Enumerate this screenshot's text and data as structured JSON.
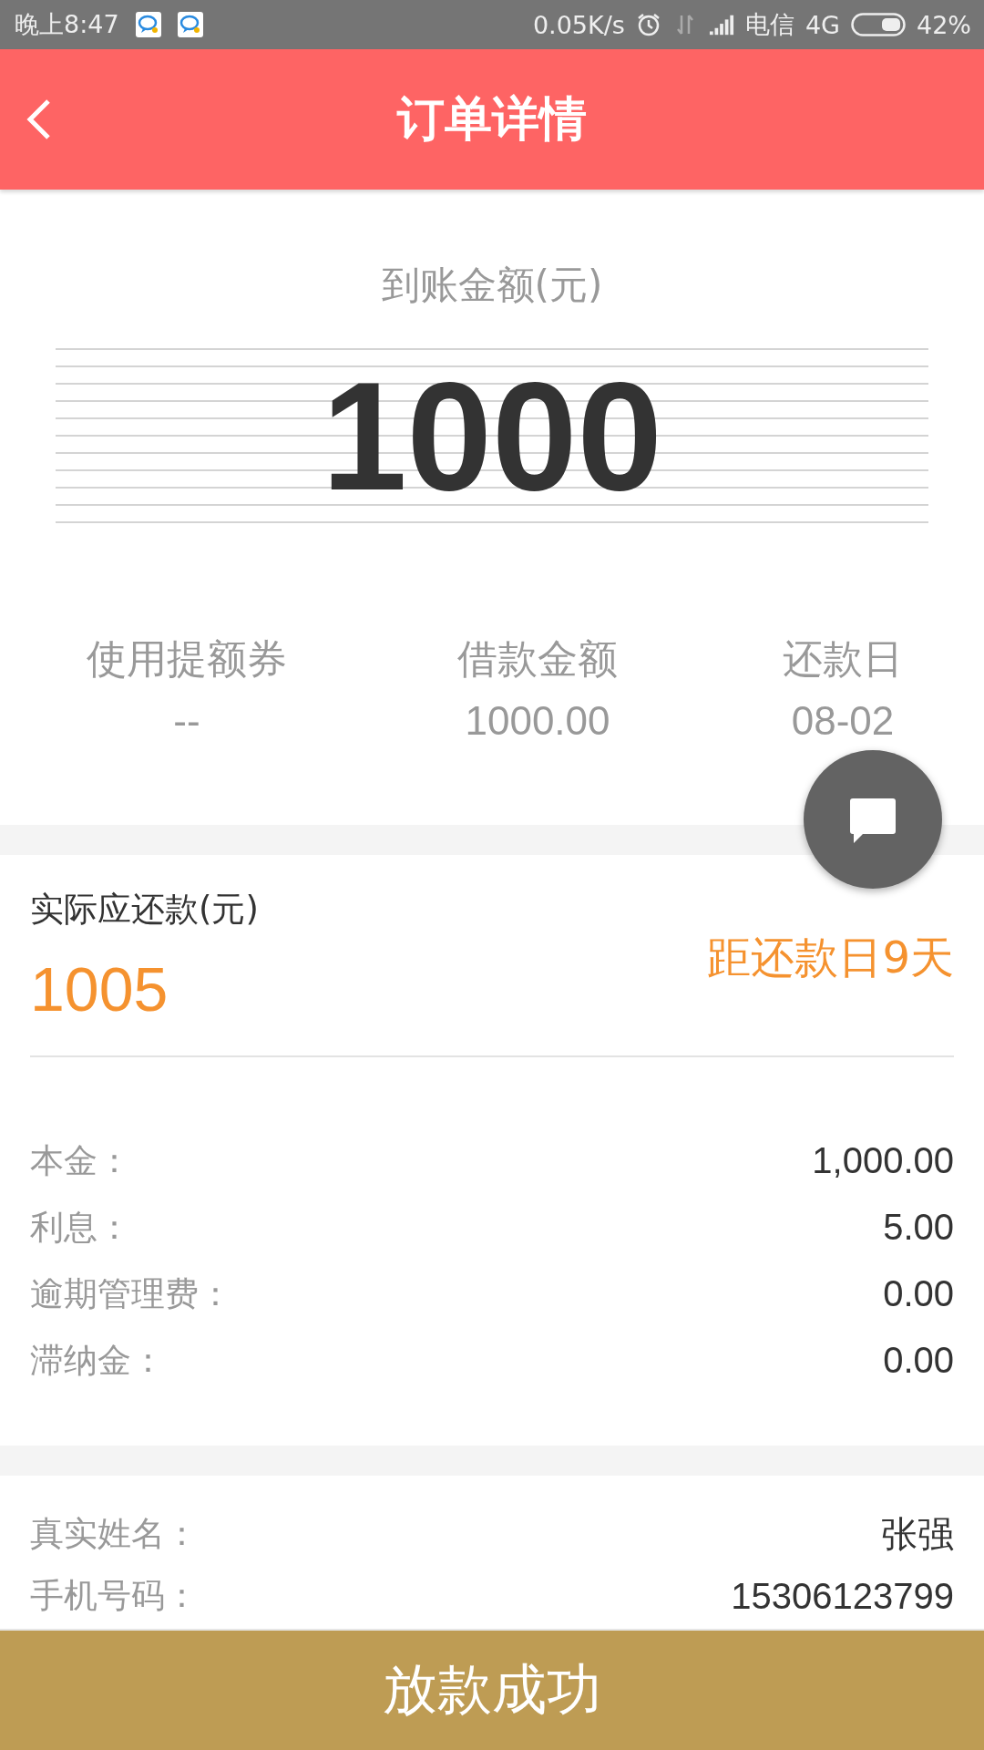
{
  "status_bar": {
    "time": "晚上8:47",
    "speed": "0.05K/s",
    "carrier": "电信",
    "network": "4G",
    "battery": "42%"
  },
  "header": {
    "title": "订单详情"
  },
  "received": {
    "label": "到账金额(元)",
    "amount": "1000"
  },
  "stats": [
    {
      "label": "使用提额券",
      "value": "--"
    },
    {
      "label": "借款金额",
      "value": "1000.00"
    },
    {
      "label": "还款日",
      "value": "08-02"
    }
  ],
  "repayment": {
    "label": "实际应还款(元)",
    "amount": "1005",
    "countdown": "距还款日9天"
  },
  "fees": [
    {
      "label": "本金：",
      "value": "1,000.00"
    },
    {
      "label": "利息：",
      "value": "5.00"
    },
    {
      "label": "逾期管理费：",
      "value": "0.00"
    },
    {
      "label": "滞纳金：",
      "value": "0.00"
    }
  ],
  "personal": [
    {
      "label": "真实姓名：",
      "value": "张强"
    },
    {
      "label": "手机号码：",
      "value": "15306123799"
    }
  ],
  "footer_button": "放款成功"
}
